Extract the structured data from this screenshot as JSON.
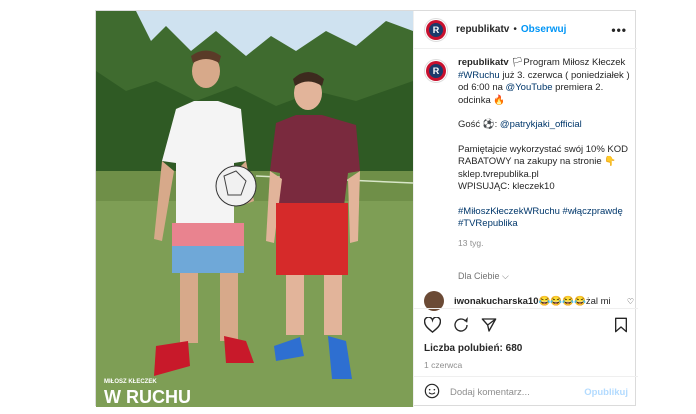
{
  "post": {
    "author": "republikatv",
    "dot": "•",
    "follow_label": "Obserwuj",
    "more_icon": "more-dots-icon",
    "caption": {
      "line1_prefix": "Program Miłosz Kłeczek ",
      "line1_tag": "#WRuchu",
      "line1_suffix": " już 3. czerwca ( poniedziałek ) od 6:00 na ",
      "line1_mention": "@YouTube",
      "line1_end": " premiera 2. odcinka 🔥",
      "guest_prefix": "Gość ⚽: ",
      "guest_mention": "@patrykjaki_official",
      "promo": "Pamiętajcie wykorzystać swój 10% KOD RABATOWY na zakupy na stronie 👇",
      "shop": "sklep.tvrepublika.pl",
      "code": "WPISUJĄC: kleczek10",
      "hashtags": "#MiłoszKłeczekWRuchu #włączprawdę #TVRepublika",
      "time": "13 tyg."
    },
    "for_you": "Dla Ciebie ⌵",
    "top_comment": {
      "user": "iwonakucharska10",
      "text": " 😂😂😂😂żal mi"
    },
    "likes_label": "Liczba polubień: 680",
    "date": "1 czerwca",
    "add_comment_placeholder": "Dodaj komentarz...",
    "publish_label": "Opublikuj",
    "photo_caption_small": "MIŁOSZ KŁECZEK",
    "photo_caption_big": "W RUCHU"
  }
}
